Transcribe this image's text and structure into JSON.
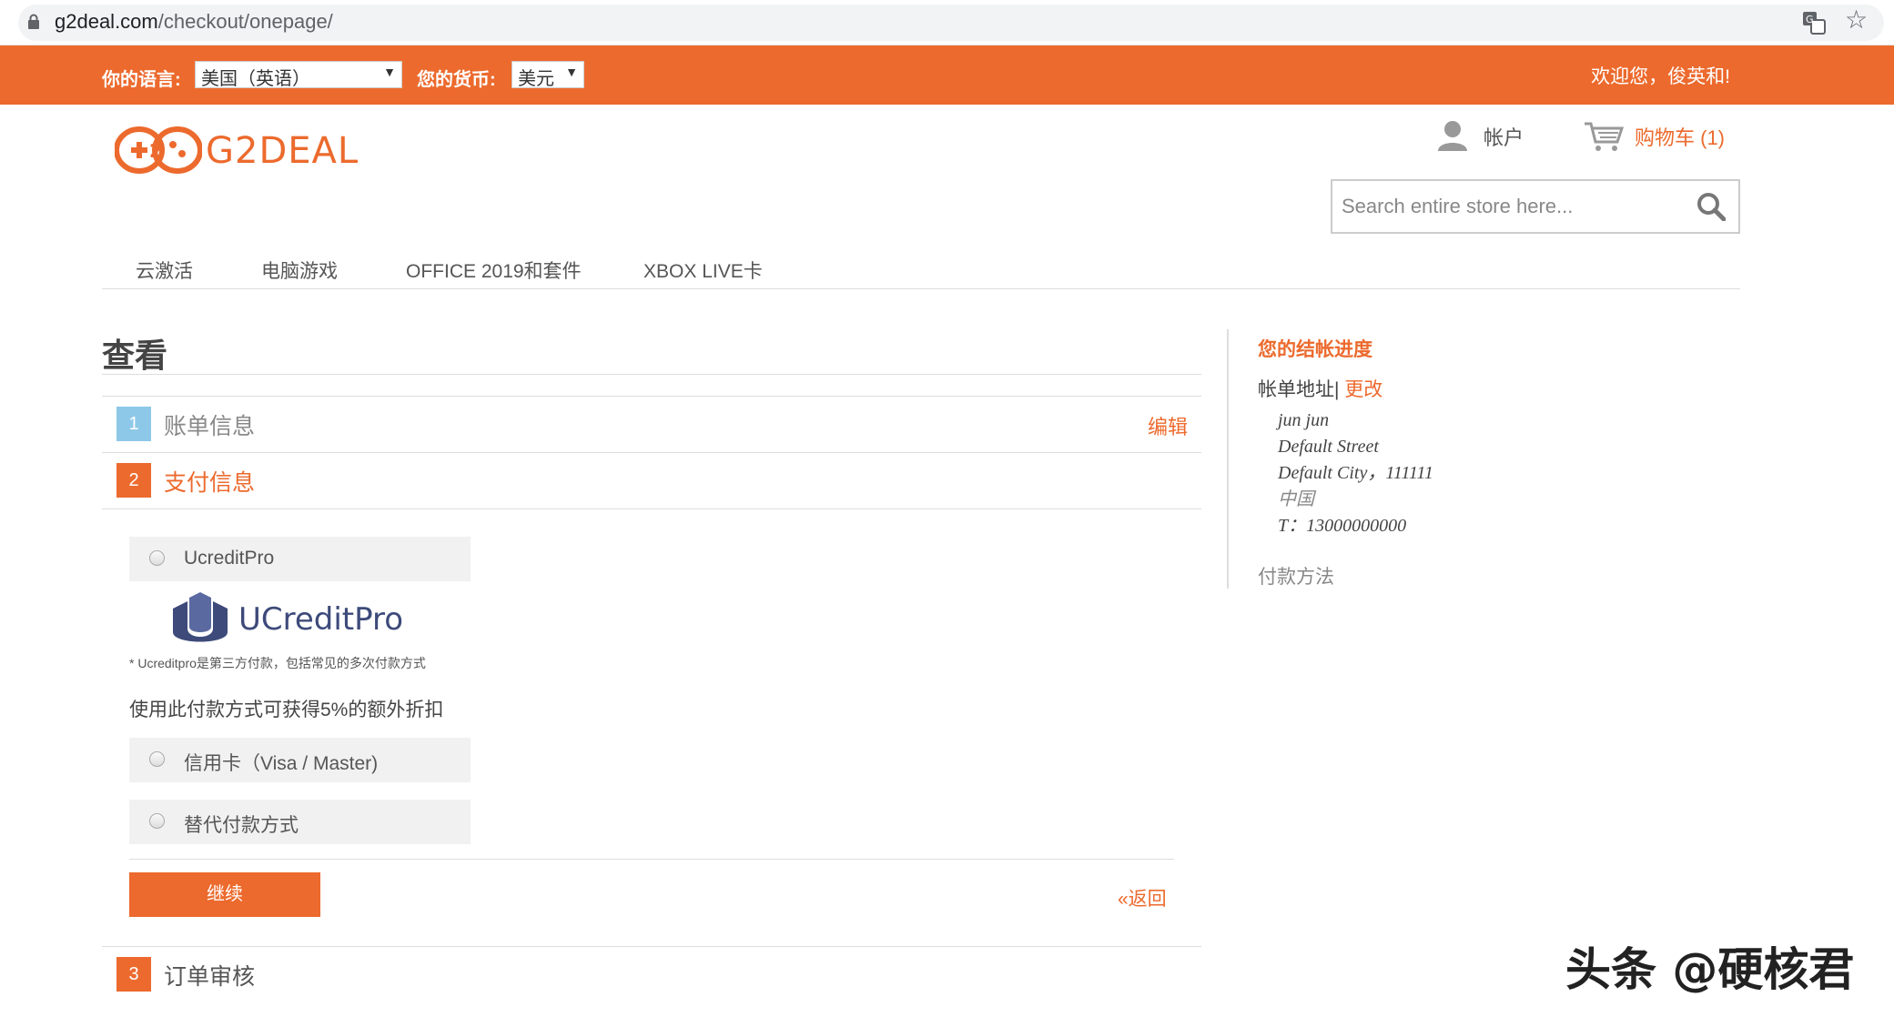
{
  "browser": {
    "url_host": "g2deal.com",
    "url_path": "/checkout/onepage/"
  },
  "topbar": {
    "language_label": "你的语言:",
    "language_value": "美国（英语）",
    "currency_label": "您的货币:",
    "currency_value": "美元",
    "welcome": "欢迎您，俊英和!"
  },
  "header": {
    "logo_text": "G2DEAL",
    "account_label": "帐户",
    "cart_label": "购物车 (1)",
    "search_placeholder": "Search entire store here..."
  },
  "nav": {
    "items": [
      "云激活",
      "电脑游戏",
      "OFFICE 2019和套件",
      "XBOX LIVE卡"
    ]
  },
  "checkout": {
    "title": "查看",
    "steps": [
      {
        "num": "1",
        "label": "账单信息"
      },
      {
        "num": "2",
        "label": "支付信息"
      },
      {
        "num": "3",
        "label": "订单审核"
      }
    ],
    "edit_label": "编辑",
    "payment_options": [
      "UcreditPro",
      "信用卡（Visa / Master)",
      "替代付款方式"
    ],
    "ucp_logo_text": "UCreditPro",
    "ucp_note": "* Ucreditpro是第三方付款，包括常见的多次付款方式",
    "discount_note": "使用此付款方式可获得5%的额外折扣",
    "continue_label": "继续",
    "back_label": "«返回"
  },
  "sidebar": {
    "title": "您的结帐进度",
    "billing_label": "帐单地址|",
    "change_label": "更改",
    "address": [
      "jun jun",
      "Default Street",
      "Default City，111111",
      "中国",
      "T：13000000000"
    ],
    "payment_method_label": "付款方法"
  },
  "watermark": "头条 @硬核君",
  "colors": {
    "accent": "#ec6a2d",
    "step_done": "#8ec8e8"
  }
}
